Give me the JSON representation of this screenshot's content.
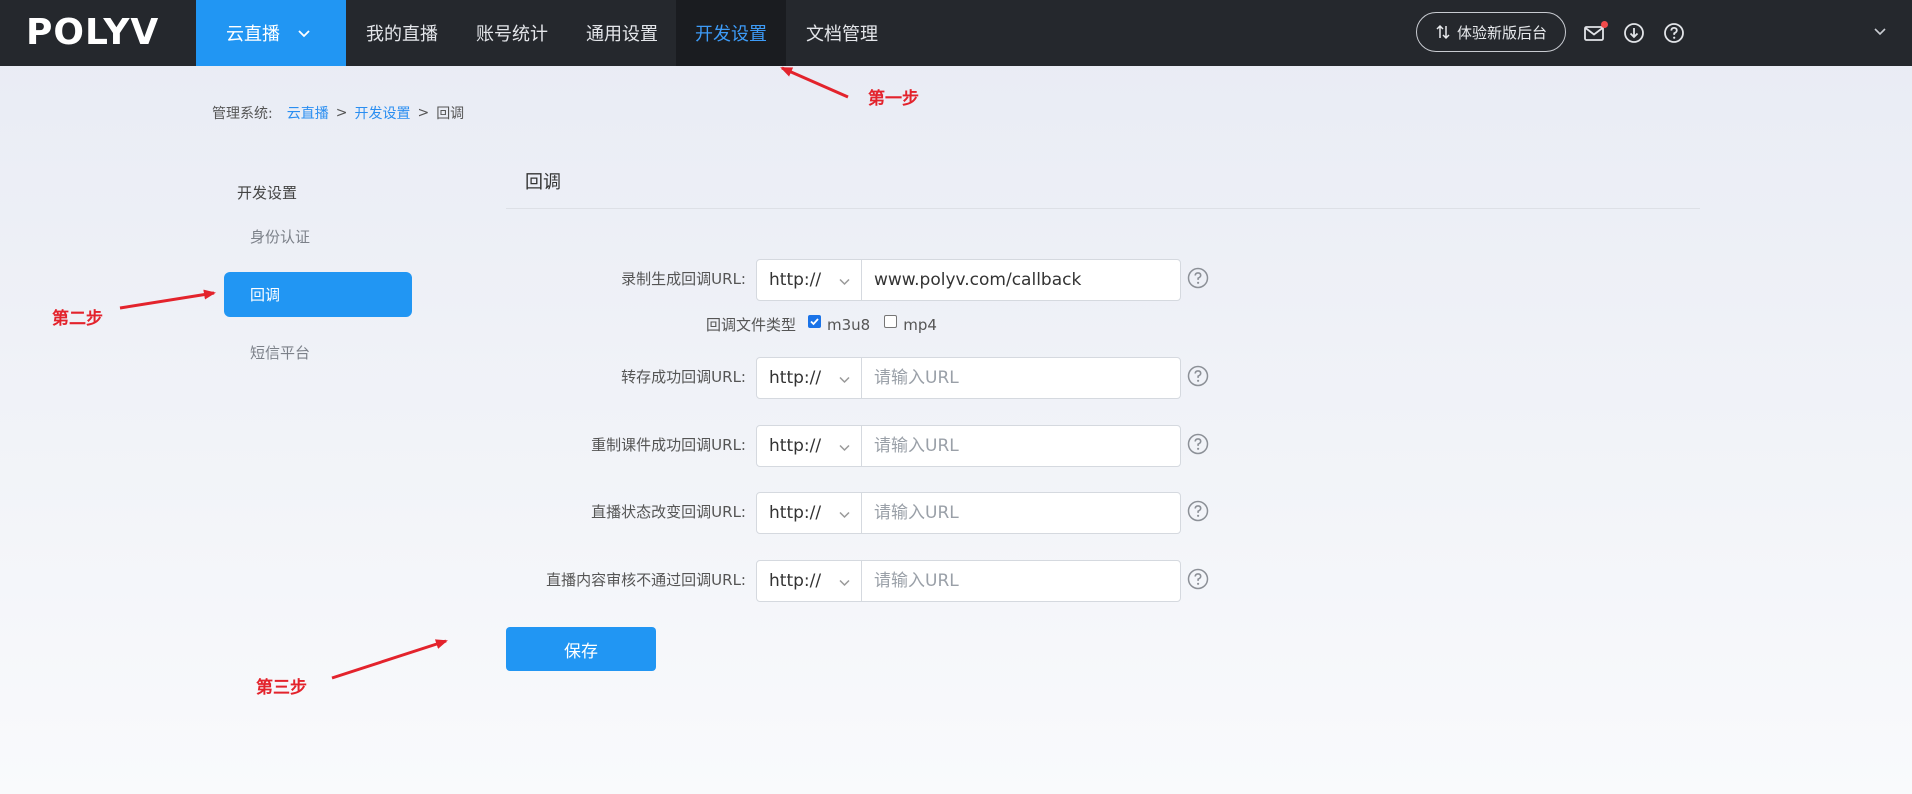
{
  "brand": {
    "logo_text": "POLYV"
  },
  "nav": {
    "items": [
      "云直播",
      "我的直播",
      "账号统计",
      "通用设置",
      "开发设置",
      "文档管理"
    ],
    "try_new_ui": "体验新版后台"
  },
  "breadcrumb": {
    "prefix": "管理系统:",
    "items": [
      "云直播",
      "开发设置",
      "回调"
    ],
    "separator": ">"
  },
  "sidebar": {
    "title": "开发设置",
    "items": [
      "身份认证",
      "回调",
      "短信平台"
    ],
    "active": "回调"
  },
  "panel": {
    "title": "回调",
    "rows": [
      {
        "label": "录制生成回调URL:",
        "protocol": "http://",
        "value": "www.polyv.com/callback",
        "placeholder": "请输入URL"
      },
      {
        "label": "转存成功回调URL:",
        "protocol": "http://",
        "value": "",
        "placeholder": "请输入URL"
      },
      {
        "label": "重制课件成功回调URL:",
        "protocol": "http://",
        "value": "",
        "placeholder": "请输入URL"
      },
      {
        "label": "直播状态改变回调URL:",
        "protocol": "http://",
        "value": "",
        "placeholder": "请输入URL"
      },
      {
        "label": "直播内容审核不通过回调URL:",
        "protocol": "http://",
        "value": "",
        "placeholder": "请输入URL"
      }
    ],
    "file_type": {
      "label": "回调文件类型",
      "options": [
        {
          "label": "m3u8",
          "checked": true
        },
        {
          "label": "mp4",
          "checked": false
        }
      ]
    },
    "save_label": "保存"
  },
  "annotations": {
    "step1": "第一步",
    "step2": "第二步",
    "step3": "第三步"
  },
  "colors": {
    "nav_bg": "#25282d",
    "accent": "#2196f3",
    "annotation": "#e3232c"
  }
}
